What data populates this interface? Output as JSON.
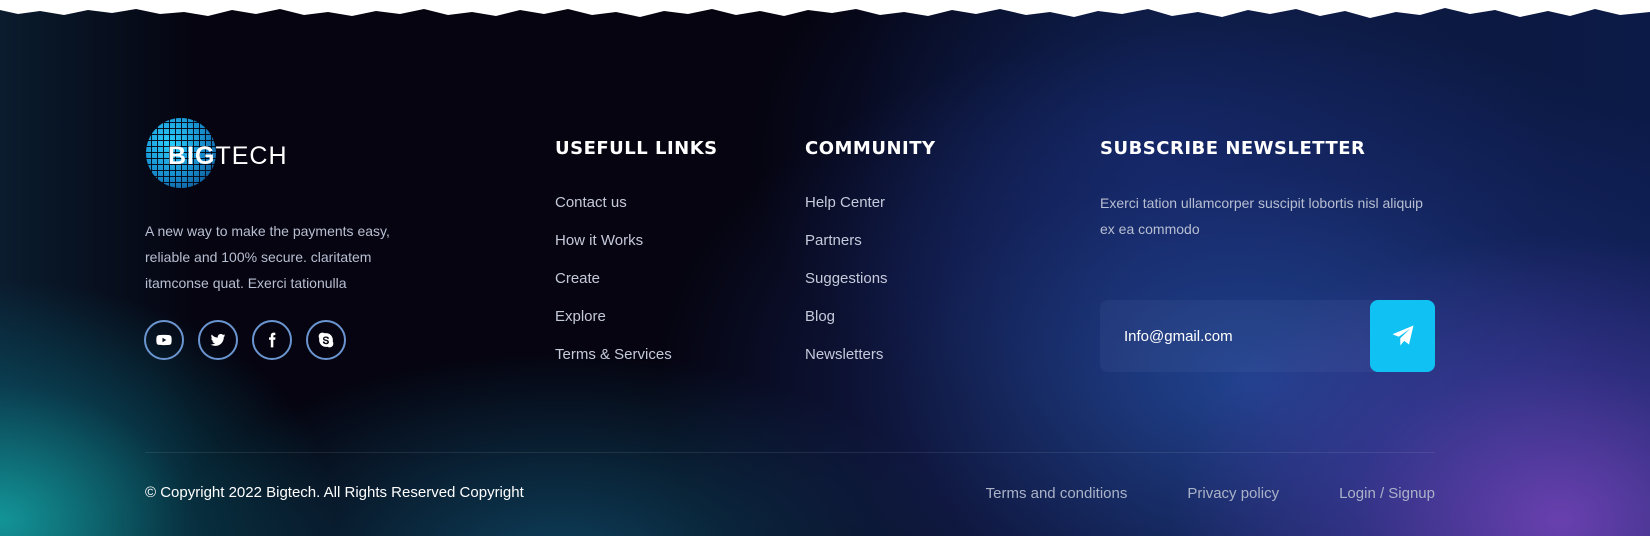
{
  "brand": {
    "logo_text_bold": "BIG",
    "logo_text_light": "TECH",
    "about": "A new way to make the payments easy, reliable and 100% secure. claritatem itamconse quat. Exerci tationulla",
    "socials": [
      {
        "name": "youtube-icon"
      },
      {
        "name": "twitter-icon"
      },
      {
        "name": "facebook-icon"
      },
      {
        "name": "skype-icon"
      }
    ]
  },
  "useful_links": {
    "title": "USEFULL LINKS",
    "items": [
      "Contact us",
      "How it Works",
      "Create",
      "Explore",
      "Terms & Services"
    ]
  },
  "community": {
    "title": "COMMUNITY",
    "items": [
      "Help Center",
      "Partners",
      "Suggestions",
      "Blog",
      "Newsletters"
    ]
  },
  "newsletter": {
    "title": "SUBSCRIBE NEWSLETTER",
    "description": "Exerci tation ullamcorper suscipit lobortis nisl aliquip ex ea commodo",
    "email_placeholder": "Info@gmail.com",
    "send_icon": "paper-plane-icon",
    "accent_color": "#10c1f3"
  },
  "bottom": {
    "copyright": "© Copyright 2022 Bigtech. All Rights Reserved Copyright",
    "links": [
      "Terms and conditions",
      "Privacy policy",
      "Login / Signup"
    ]
  }
}
